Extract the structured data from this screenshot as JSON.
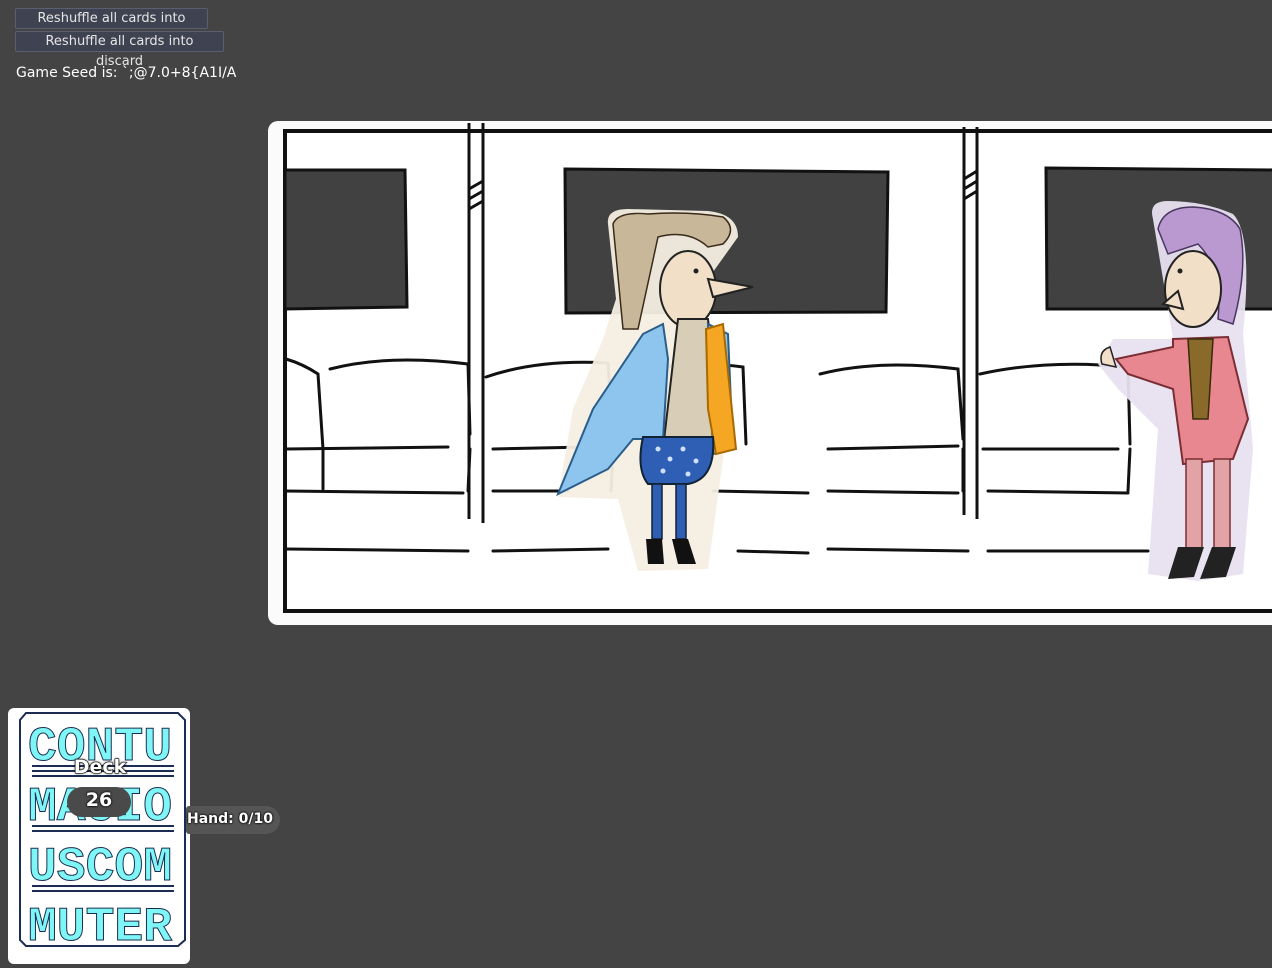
{
  "controls": {
    "reshuffle_deck_label": "Reshuffle all cards into deck",
    "reshuffle_discard_label": "Reshuffle all cards into discard"
  },
  "seed": {
    "text": "Game Seed is: `;@7.0+8{A1I/A"
  },
  "deck": {
    "label": "Deck",
    "count": "26",
    "card_back_lines": [
      "CONTU",
      "MACIO",
      "USCOM",
      "MUTER"
    ]
  },
  "hand": {
    "label": "Hand: 0/10"
  },
  "colors": {
    "background": "#444444",
    "card_back_text": "#7ef6f6",
    "card_back_navy": "#1b2d52",
    "coat_blue": "#8ec5ee",
    "scarf_orange": "#f5a623",
    "skirt_blue": "#2e5fb5",
    "shirt_red": "#e88790",
    "hair_purple": "#b999cf"
  }
}
